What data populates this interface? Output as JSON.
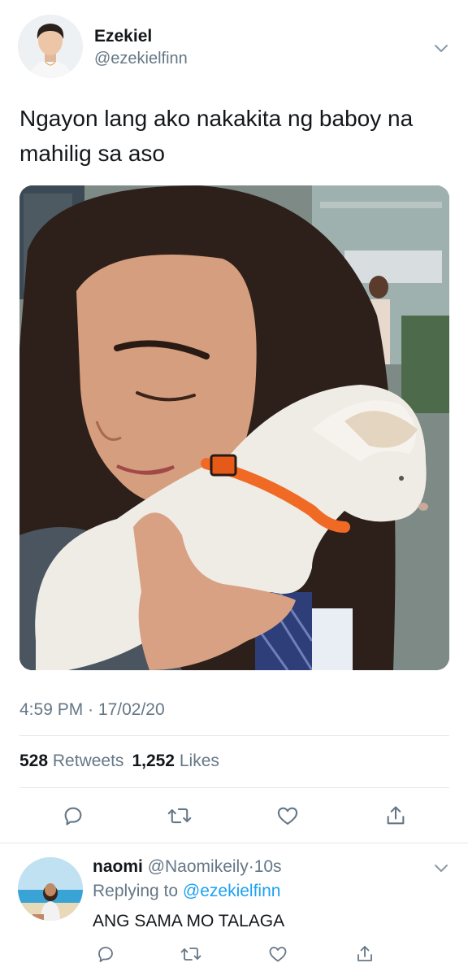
{
  "tweet": {
    "author_name": "Ezekiel",
    "author_handle": "@ezekielfinn",
    "text": "Ngayon lang ako nakakita ng baboy na mahilig sa aso",
    "media_alt": "Photo of a girl hugging a white puppy wearing an orange harness",
    "time": "4:59 PM",
    "dot": "·",
    "date": "17/02/20",
    "retweets_count": "528",
    "retweets_label": "Retweets",
    "likes_count": "1,252",
    "likes_label": "Likes"
  },
  "reply": {
    "author_name": "naomi",
    "author_handle": "@Naomikeily",
    "dot": "·",
    "age": "10s",
    "replying_label": "Replying to",
    "replying_to": "@ezekielfinn",
    "text": "ANG SAMA MO TALAGA"
  },
  "icons": {
    "reply": "reply-icon",
    "retweet": "retweet-icon",
    "like": "heart-icon",
    "share": "share-icon",
    "caret": "chevron-down-icon"
  },
  "colors": {
    "icon_gray": "#657786",
    "link_blue": "#1da1f2",
    "divider": "#e1e8ed"
  }
}
